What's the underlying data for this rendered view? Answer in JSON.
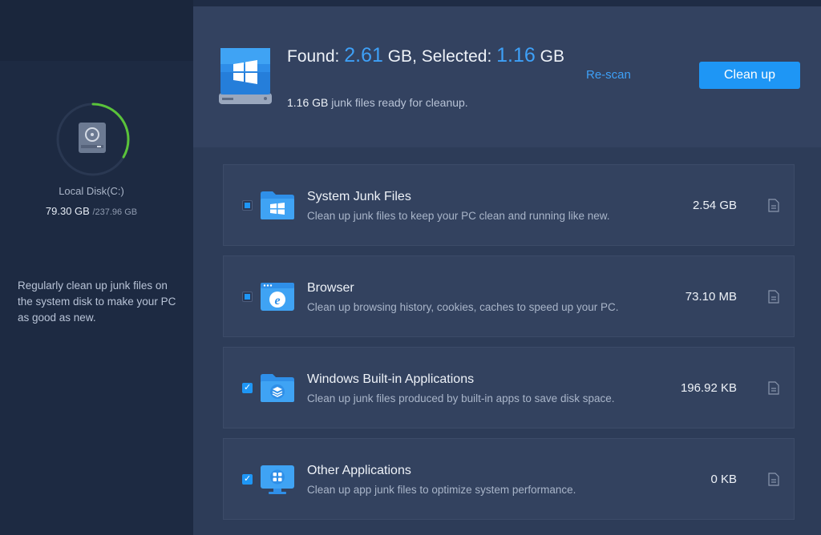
{
  "sidebar": {
    "disk_name": "Local Disk(C:)",
    "disk_used": "79.30 GB",
    "disk_total": "/237.96 GB",
    "used_fraction": 0.333,
    "tip": "Regularly clean up junk files on the system disk to make your PC as good as new."
  },
  "summary": {
    "found_label": "Found: ",
    "found_value": "2.61",
    "found_unit": " GB, Selected: ",
    "selected_value": "1.16",
    "selected_unit": " GB",
    "ready_value": "1.16 GB",
    "ready_text": " junk files ready for cleanup.",
    "rescan_label": "Re-scan",
    "cleanup_label": "Clean up"
  },
  "categories": [
    {
      "title": "System Junk Files",
      "desc": "Clean up junk files to keep your PC clean and running like new.",
      "size": "2.54 GB",
      "state": "partial",
      "icon": "windows-folder-icon"
    },
    {
      "title": "Browser",
      "desc": "Clean up browsing history, cookies, caches to speed up your PC.",
      "size": "73.10 MB",
      "state": "partial",
      "icon": "browser-window-icon"
    },
    {
      "title": "Windows Built-in Applications",
      "desc": "Clean up junk files produced by built-in apps to save disk space.",
      "size": "196.92 KB",
      "state": "checked",
      "icon": "layers-folder-icon"
    },
    {
      "title": "Other Applications",
      "desc": "Clean up app junk files to optimize system performance.",
      "size": "0 KB",
      "state": "checked",
      "icon": "apps-monitor-icon"
    }
  ],
  "colors": {
    "accent": "#1e96f5",
    "ring_progress": "#5ac33a",
    "highlight": "#3ea0f7"
  }
}
